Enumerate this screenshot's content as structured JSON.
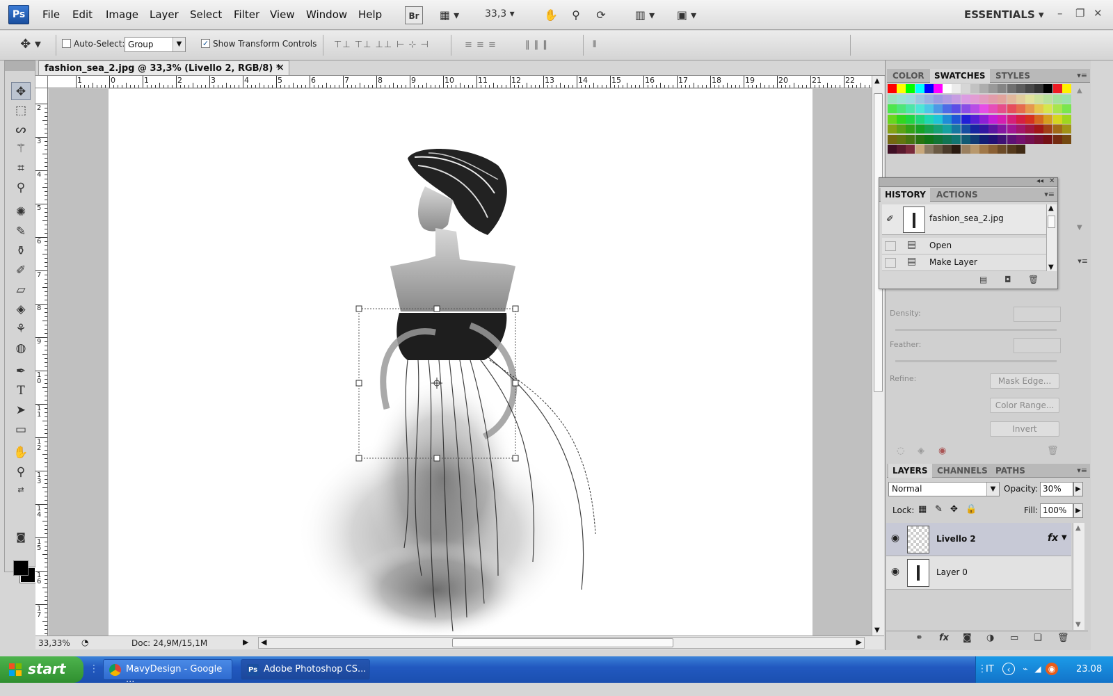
{
  "app": {
    "logo": "Ps"
  },
  "menu": {
    "items": [
      "File",
      "Edit",
      "Image",
      "Layer",
      "Select",
      "Filter",
      "View",
      "Window",
      "Help"
    ]
  },
  "appbar": {
    "bridge": "Br",
    "zoom": "33,3",
    "workspace": "ESSENTIALS"
  },
  "options": {
    "auto_select_label": "Auto-Select:",
    "auto_select_checked": false,
    "auto_select_mode": "Group",
    "show_transform_label": "Show Transform Controls",
    "show_transform_checked": true
  },
  "document": {
    "tab_title": "fashion_sea_2.jpg @ 33,3% (Livello 2, RGB/8) *",
    "ruler_top": [
      "1",
      "0",
      "1",
      "2",
      "3",
      "4",
      "5",
      "6",
      "7",
      "8",
      "9",
      "10",
      "11",
      "12",
      "13",
      "14",
      "15",
      "16",
      "17",
      "18",
      "19",
      "20",
      "21",
      "22"
    ],
    "ruler_left": [
      "2",
      "3",
      "4",
      "5",
      "6",
      "7",
      "8",
      "9",
      "1 0",
      "1 1",
      "1 2",
      "1 3",
      "1 4",
      "1 5",
      "1 6",
      "1 7"
    ],
    "status_zoom": "33,33%",
    "doc_info": "Doc: 24,9M/15,1M"
  },
  "panels": {
    "color_tabs": [
      "COLOR",
      "SWATCHES",
      "STYLES"
    ],
    "history_tabs": [
      "HISTORY",
      "ACTIONS"
    ],
    "history_snapshot": "fashion_sea_2.jpg",
    "history_items": [
      "Open",
      "Make Layer"
    ],
    "masks": {
      "density_label": "Density:",
      "feather_label": "Feather:",
      "refine_label": "Refine:",
      "buttons": [
        "Mask Edge...",
        "Color Range...",
        "Invert"
      ]
    },
    "layers_tabs": [
      "LAYERS",
      "CHANNELS",
      "PATHS"
    ],
    "blend_mode": "Normal",
    "opacity_label": "Opacity:",
    "opacity": "30%",
    "lock_label": "Lock:",
    "fill_label": "Fill:",
    "fill": "100%",
    "layers": [
      {
        "name": "Livello 2",
        "selected": true,
        "has_fx": true,
        "fx": "fx"
      },
      {
        "name": "Layer 0",
        "selected": false,
        "has_fx": false
      }
    ]
  },
  "taskbar": {
    "start": "start",
    "tasks": [
      {
        "label": "MavyDesign - Google ...",
        "icon": "chrome-icon"
      },
      {
        "label": "Adobe Photoshop CS...",
        "icon": "photoshop-icon",
        "active": true
      }
    ],
    "lang": "IT",
    "clock": "23.08"
  },
  "colors": {
    "accent": "#2a5fb8",
    "selection": "#c7c9d6",
    "canvas_bg": "#c0c0c0"
  }
}
